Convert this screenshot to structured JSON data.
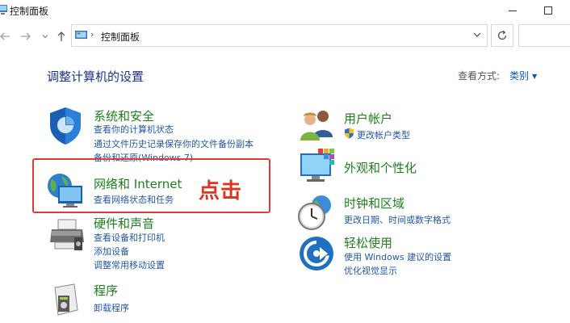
{
  "window": {
    "title": "控制面板"
  },
  "address_bar": {
    "path_item": "控制面板",
    "separator": "›"
  },
  "main": {
    "heading": "调整计算机的设置",
    "view_by_label": "查看方式:",
    "view_by_value": "类别"
  },
  "categories_left": [
    {
      "title": "系统和安全",
      "links": [
        "查看你的计算机状态",
        "通过文件历史记录保存你的文件备份副本",
        "备份和还原(Windows 7)"
      ]
    },
    {
      "title": "网络和 Internet",
      "links": [
        "查看网络状态和任务"
      ]
    },
    {
      "title": "硬件和声音",
      "links": [
        "查看设备和打印机",
        "添加设备",
        "调整常用移动设置"
      ]
    },
    {
      "title": "程序",
      "links": [
        "卸载程序"
      ]
    }
  ],
  "categories_right": [
    {
      "title": "用户帐户",
      "links": [
        "更改帐户类型"
      ]
    },
    {
      "title": "外观和个性化",
      "links": []
    },
    {
      "title": "时钟和区域",
      "links": [
        "更改日期、时间或数字格式"
      ]
    },
    {
      "title": "轻松使用",
      "links": [
        "使用 Windows 建议的设置",
        "优化视觉显示"
      ]
    }
  ],
  "annotation": {
    "text": "点击"
  },
  "colors": {
    "category_title": "#1d7f1d",
    "link": "#2257a8",
    "heading": "#1e3287",
    "annotation": "#e03a3a"
  }
}
